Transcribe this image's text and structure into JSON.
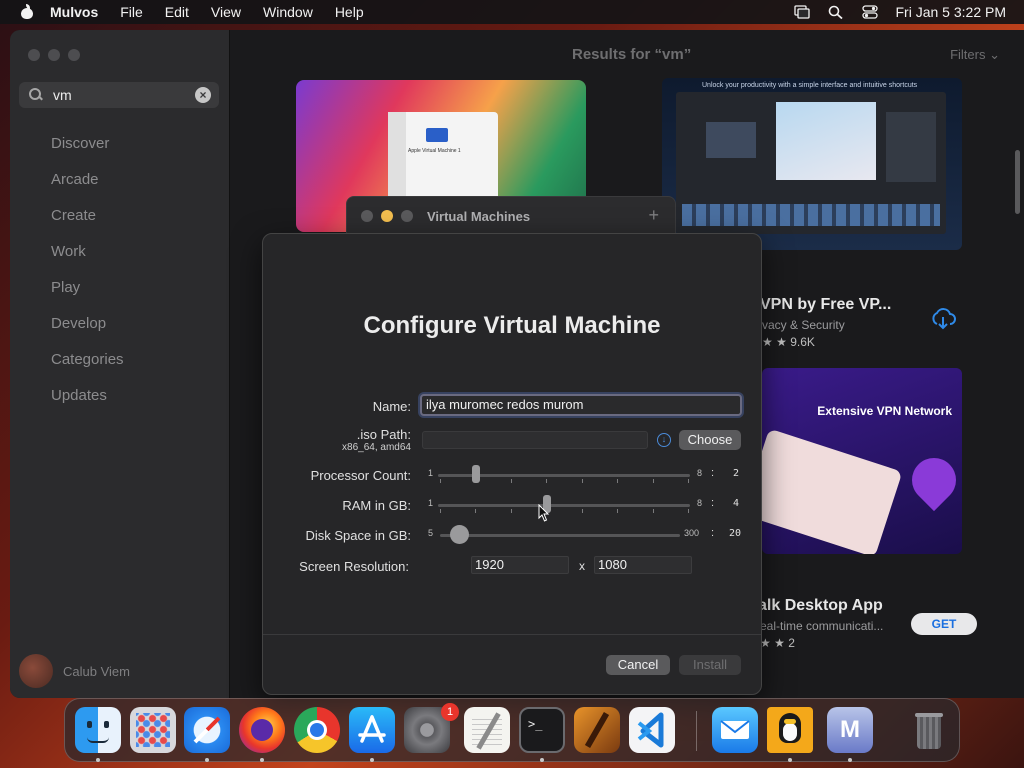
{
  "menubar": {
    "app_name": "Mulvos",
    "items": [
      "File",
      "Edit",
      "View",
      "Window",
      "Help"
    ],
    "datetime": "Fri Jan 5  3:22 PM"
  },
  "sidebar": {
    "search_value": "vm",
    "nav": [
      "Discover",
      "Arcade",
      "Create",
      "Work",
      "Play",
      "Develop",
      "Categories",
      "Updates"
    ],
    "user_name": "Calub Viem"
  },
  "content": {
    "title": "Results for “vm”",
    "filters_label": "Filters",
    "card2_caption": "Unlock your productivity with a simple interface and intuitive shortcuts",
    "card1_mini_title": "Apple Virtual Machine 1",
    "app1": {
      "name": "VPN by Free VP...",
      "category": "vacy & Security",
      "rating_count": "9.6K"
    },
    "promo_text": "Extensive VPN Network",
    "app2": {
      "name": "alk Desktop App",
      "category": "eal-time communicati...",
      "rating_count": "2",
      "get_label": "GET"
    }
  },
  "vm_window": {
    "title": "Virtual Machines",
    "plus": "+"
  },
  "configure_sheet": {
    "heading": "Configure Virtual Machine",
    "name_label": "Name:",
    "name_value": "ilya muromec redos murom",
    "iso_label": ".iso Path:",
    "iso_sub": "x86_64, amd64",
    "choose_label": "Choose",
    "processor": {
      "label": "Processor Count:",
      "min": "1",
      "max": "8",
      "value": "2"
    },
    "ram": {
      "label": "RAM in GB:",
      "min": "1",
      "max": "8",
      "value": "4"
    },
    "disk": {
      "label": "Disk Space in GB:",
      "min": "5",
      "max": "300",
      "value": "20"
    },
    "resolution": {
      "label": "Screen Resolution:",
      "width": "1920",
      "x": "x",
      "height": "1080"
    },
    "cancel_label": "Cancel",
    "install_label": "Install"
  },
  "dock": {
    "apps": [
      "finder-icon",
      "launchpad-icon",
      "safari-icon",
      "firefox-icon",
      "chrome-icon",
      "app-store-icon",
      "system-settings-icon",
      "textedit-icon",
      "terminal-icon",
      "garageband-icon",
      "vscode-icon",
      "mail-icon",
      "tux-icon",
      "m-app-icon",
      "trash-icon"
    ],
    "settings_badge": "1",
    "m_app_letter": "M"
  }
}
